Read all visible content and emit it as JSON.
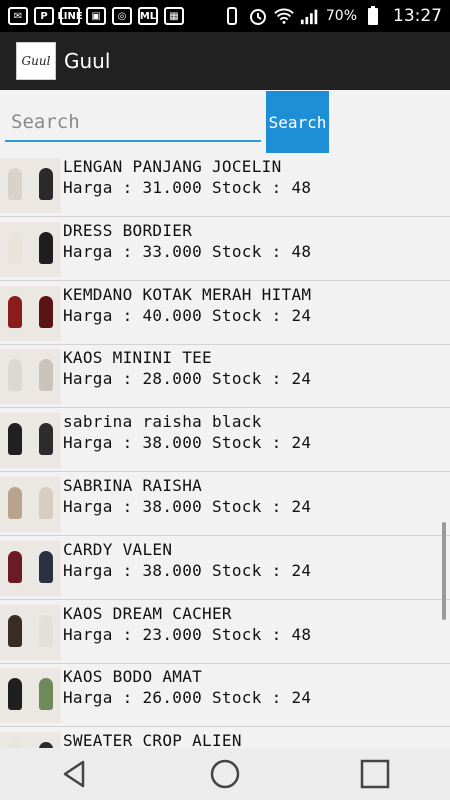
{
  "status_bar": {
    "left_icons": [
      {
        "name": "messenger-icon",
        "glyph": "✉"
      },
      {
        "name": "pinterest-icon",
        "glyph": "P"
      },
      {
        "name": "line-icon",
        "glyph": "LINE"
      },
      {
        "name": "gallery-icon",
        "glyph": "▣"
      },
      {
        "name": "instagram-icon",
        "glyph": "◎"
      },
      {
        "name": "ml-icon",
        "glyph": "ML"
      },
      {
        "name": "app-icon",
        "glyph": "▦"
      }
    ],
    "battery_percent": "70%",
    "time": "13:27"
  },
  "app_bar": {
    "logo_text": "Guul",
    "title": "Guul"
  },
  "search": {
    "placeholder": "Search",
    "value": "",
    "button_label": "Search"
  },
  "products": [
    {
      "name": "LENGAN PANJANG JOCELIN",
      "detail": "Harga : 31.000 Stock : 48",
      "colors": [
        "#d9d2ca",
        "#2a2a2a"
      ]
    },
    {
      "name": "DRESS BORDIER",
      "detail": "Harga : 33.000 Stock : 48",
      "colors": [
        "#e8e4dc",
        "#1e1e1e"
      ]
    },
    {
      "name": "KEMDANO KOTAK MERAH HITAM",
      "detail": "Harga : 40.000 Stock : 24",
      "colors": [
        "#8a1c1c",
        "#5a1414"
      ]
    },
    {
      "name": "KAOS MININI TEE",
      "detail": "Harga : 28.000 Stock : 24",
      "colors": [
        "#dcd8d2",
        "#c9c3bb"
      ]
    },
    {
      "name": "sabrina raisha black",
      "detail": "Harga : 38.000 Stock : 24",
      "colors": [
        "#202020",
        "#2c2c2c"
      ]
    },
    {
      "name": "SABRINA RAISHA",
      "detail": "Harga : 38.000 Stock : 24",
      "colors": [
        "#b9a38c",
        "#d8cdbf"
      ]
    },
    {
      "name": "CARDY VALEN",
      "detail": "Harga : 38.000 Stock : 24",
      "colors": [
        "#6b1c22",
        "#2a3242"
      ]
    },
    {
      "name": "KAOS DREAM CACHER",
      "detail": "Harga : 23.000 Stock : 48",
      "colors": [
        "#3b2b25",
        "#e3dfdb"
      ]
    },
    {
      "name": "KAOS BODO AMAT",
      "detail": "Harga : 26.000 Stock : 24",
      "colors": [
        "#1f1f1f",
        "#6f8a5a"
      ]
    },
    {
      "name": "SWEATER CROP ALIEN",
      "detail": "",
      "colors": [
        "#e6e2de",
        "#2a2a2a"
      ]
    }
  ],
  "colors": {
    "accent": "#1e8fd6",
    "app_bar": "#212121",
    "background": "#f2f2f2"
  }
}
